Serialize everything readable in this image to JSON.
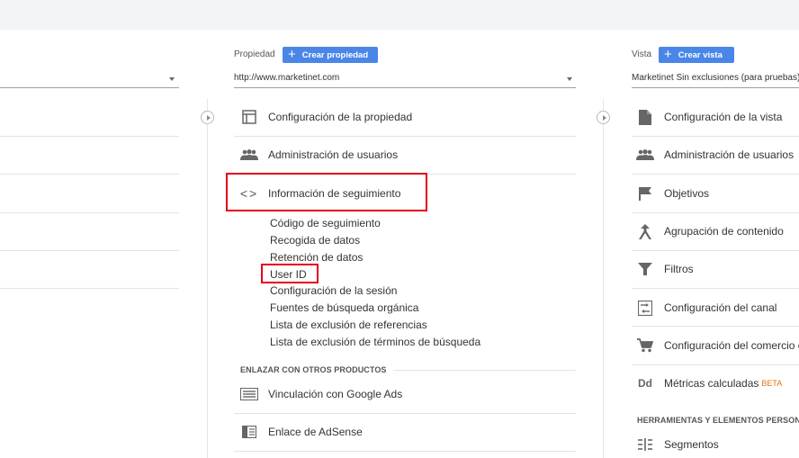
{
  "property": {
    "label": "Propiedad",
    "create_button": "Crear propiedad",
    "selected": "http://www.marketinet.com",
    "items": [
      {
        "label": "Configuración de la propiedad",
        "icon": "property-settings-icon"
      },
      {
        "label": "Administración de usuarios",
        "icon": "users-icon"
      },
      {
        "label": "Información de seguimiento",
        "icon": "code-icon"
      }
    ],
    "tracking_subitems": [
      "Código de seguimiento",
      "Recogida de datos",
      "Retención de datos",
      "User ID",
      "Configuración de la sesión",
      "Fuentes de búsqueda orgánica",
      "Lista de exclusión de referencias",
      "Lista de exclusión de términos de búsqueda"
    ],
    "linking_header": "ENLAZAR CON OTROS PRODUCTOS",
    "linking_items": [
      {
        "label": "Vinculación con Google Ads",
        "icon": "google-ads-icon"
      },
      {
        "label": "Enlace de AdSense",
        "icon": "adsense-icon"
      }
    ]
  },
  "view": {
    "label": "Vista",
    "create_button": "Crear vista",
    "selected": "Marketinet Sin exclusiones (para pruebas)",
    "items": [
      {
        "label": "Configuración de la vista",
        "icon": "document-icon"
      },
      {
        "label": "Administración de usuarios",
        "icon": "users-icon"
      },
      {
        "label": "Objetivos",
        "icon": "flag-icon"
      },
      {
        "label": "Agrupación de contenido",
        "icon": "content-grouping-icon"
      },
      {
        "label": "Filtros",
        "icon": "filter-icon"
      },
      {
        "label": "Configuración del canal",
        "icon": "channel-icon"
      },
      {
        "label": "Configuración del comercio e",
        "icon": "cart-icon"
      },
      {
        "label": "Métricas calculadas",
        "icon": "dd-icon",
        "badge": "BETA"
      }
    ],
    "tools_header": "HERRAMIENTAS Y ELEMENTOS PERSON",
    "tools_items": [
      {
        "label": "Segmentos",
        "icon": "segments-icon"
      }
    ]
  },
  "colors": {
    "button_blue": "#4a86e8",
    "highlight_red": "#e2001a",
    "beta_orange": "#e8710a"
  }
}
